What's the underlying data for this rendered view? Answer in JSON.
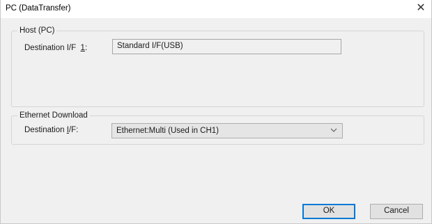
{
  "window": {
    "title": "PC (DataTransfer)",
    "close_glyph": "✕"
  },
  "host_group": {
    "legend": "Host (PC)",
    "dest_label_prefix": "Destination I/F  ",
    "dest_label_accel": "1",
    "dest_label_suffix": ":",
    "dest_value": "Standard I/F(USB)"
  },
  "ethernet_group": {
    "legend": "Ethernet Download",
    "dest_label_prefix": "Destination ",
    "dest_label_accel": "I",
    "dest_label_suffix": "/F:",
    "dest_selected": "Ethernet:Multi (Used in CH1)"
  },
  "buttons": {
    "ok": "OK",
    "cancel": "Cancel"
  },
  "colors": {
    "default_button_border": "#0078d7",
    "dialog_background": "#f0f0f0"
  }
}
